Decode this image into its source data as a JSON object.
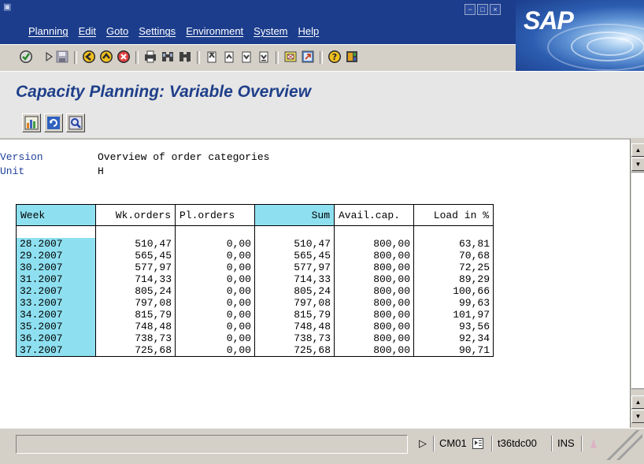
{
  "menu": [
    "Planning",
    "Edit",
    "Goto",
    "Settings",
    "Environment",
    "System",
    "Help"
  ],
  "logo": "SAP",
  "title": "Capacity Planning: Variable Overview",
  "info": {
    "version_label": "Version",
    "version_value": "Overview of order categories",
    "unit_label": "Unit",
    "unit_value": "H"
  },
  "table": {
    "headers": [
      "Week",
      "Wk.orders",
      "Pl.orders",
      "Sum",
      "Avail.cap.",
      "Load in %"
    ],
    "rows": [
      [
        "28.2007",
        "510,47",
        "0,00",
        "510,47",
        "800,00",
        "63,81"
      ],
      [
        "29.2007",
        "565,45",
        "0,00",
        "565,45",
        "800,00",
        "70,68"
      ],
      [
        "30.2007",
        "577,97",
        "0,00",
        "577,97",
        "800,00",
        "72,25"
      ],
      [
        "31.2007",
        "714,33",
        "0,00",
        "714,33",
        "800,00",
        "89,29"
      ],
      [
        "32.2007",
        "805,24",
        "0,00",
        "805,24",
        "800,00",
        "100,66"
      ],
      [
        "33.2007",
        "797,08",
        "0,00",
        "797,08",
        "800,00",
        "99,63"
      ],
      [
        "34.2007",
        "815,79",
        "0,00",
        "815,79",
        "800,00",
        "101,97"
      ],
      [
        "35.2007",
        "748,48",
        "0,00",
        "748,48",
        "800,00",
        "93,56"
      ],
      [
        "36.2007",
        "738,73",
        "0,00",
        "738,73",
        "800,00",
        "92,34"
      ],
      [
        "37.2007",
        "725,68",
        "0,00",
        "725,68",
        "800,00",
        "90,71"
      ]
    ]
  },
  "status": {
    "transaction": "CM01",
    "server": "t36tdc00",
    "mode": "INS"
  },
  "colors": {
    "title_bar": "#1c3d8c",
    "title_text": "#1f3f8a",
    "week_cell": "#8ee0f0",
    "label_text": "#1f3f9a"
  },
  "icons": {
    "toolbar": [
      "enter-icon",
      "command-field-icon",
      "save-icon",
      "back-icon",
      "exit-icon",
      "cancel-icon",
      "print-icon",
      "find-icon",
      "find-next-icon",
      "first-page-icon",
      "previous-page-icon",
      "next-page-icon",
      "last-page-icon",
      "create-session-icon",
      "shortcut-icon",
      "help-icon",
      "layout-menu-icon"
    ],
    "application": [
      "chart-icon",
      "refresh-icon",
      "details-icon"
    ]
  }
}
